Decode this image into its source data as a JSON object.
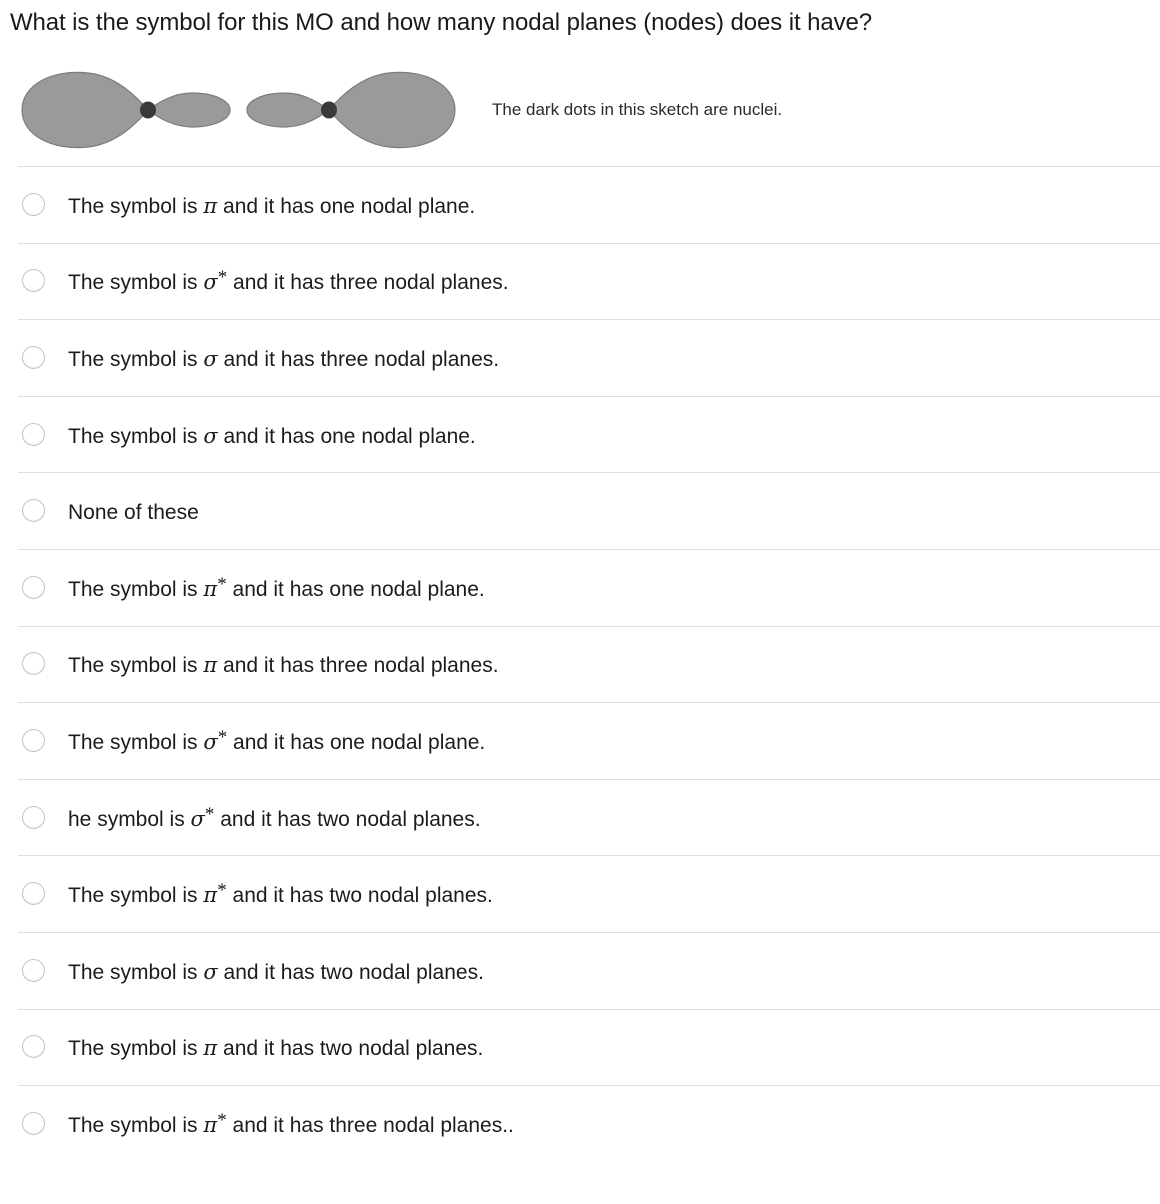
{
  "question": {
    "prompt": "What is the symbol for this MO and how many nodal planes (nodes) does it have?"
  },
  "figure": {
    "caption": "The dark dots in this sketch are nuclei.",
    "lobe_color": "#9a9a99",
    "lobe_stroke": "#7c7c7b",
    "nucleus_color": "#3a3a3a",
    "description": "two antibonding-style orbital sketches, each with one large lobe and one small lobe meeting at a dark nucleus dot",
    "orbitals": [
      {
        "orientation": "large-left",
        "nucleus_label": "nucleus-dot"
      },
      {
        "orientation": "large-right",
        "nucleus_label": "nucleus-dot"
      }
    ]
  },
  "options": [
    {
      "id": "opt-1",
      "pre": "The symbol is ",
      "symbol": "π",
      "star": "",
      "post": " and it has one nodal plane.",
      "selected": false
    },
    {
      "id": "opt-2",
      "pre": "The symbol is ",
      "symbol": "σ",
      "star": "*",
      "post": " and it has three nodal planes.",
      "selected": false
    },
    {
      "id": "opt-3",
      "pre": "The symbol is ",
      "symbol": "σ",
      "star": "",
      "post": " and it has three nodal planes.",
      "selected": false
    },
    {
      "id": "opt-4",
      "pre": "The symbol is ",
      "symbol": "σ",
      "star": "",
      "post": " and it has one nodal plane.",
      "selected": false
    },
    {
      "id": "opt-5",
      "pre": "None of these",
      "symbol": "",
      "star": "",
      "post": "",
      "selected": false
    },
    {
      "id": "opt-6",
      "pre": "The symbol is ",
      "symbol": "π",
      "star": "*",
      "post": " and it has one nodal plane.",
      "selected": false
    },
    {
      "id": "opt-7",
      "pre": "The symbol is ",
      "symbol": "π",
      "star": "",
      "post": " and it has three nodal planes.",
      "selected": false
    },
    {
      "id": "opt-8",
      "pre": "The symbol is ",
      "symbol": "σ",
      "star": "*",
      "post": " and it has one nodal plane.",
      "selected": false
    },
    {
      "id": "opt-9",
      "pre": "he symbol is ",
      "symbol": "σ",
      "star": "*",
      "post": " and it has two nodal planes.",
      "selected": false
    },
    {
      "id": "opt-10",
      "pre": "The symbol is ",
      "symbol": "π",
      "star": "*",
      "post": " and it has two nodal planes.",
      "selected": false
    },
    {
      "id": "opt-11",
      "pre": "The symbol is ",
      "symbol": "σ",
      "star": "",
      "post": " and it has two nodal planes.",
      "selected": false
    },
    {
      "id": "opt-12",
      "pre": "The symbol is ",
      "symbol": "π",
      "star": "",
      "post": " and it has two nodal planes.",
      "selected": false
    },
    {
      "id": "opt-13",
      "pre": "The symbol is ",
      "symbol": "π",
      "star": "*",
      "post": " and it has three nodal planes..",
      "selected": false
    }
  ]
}
